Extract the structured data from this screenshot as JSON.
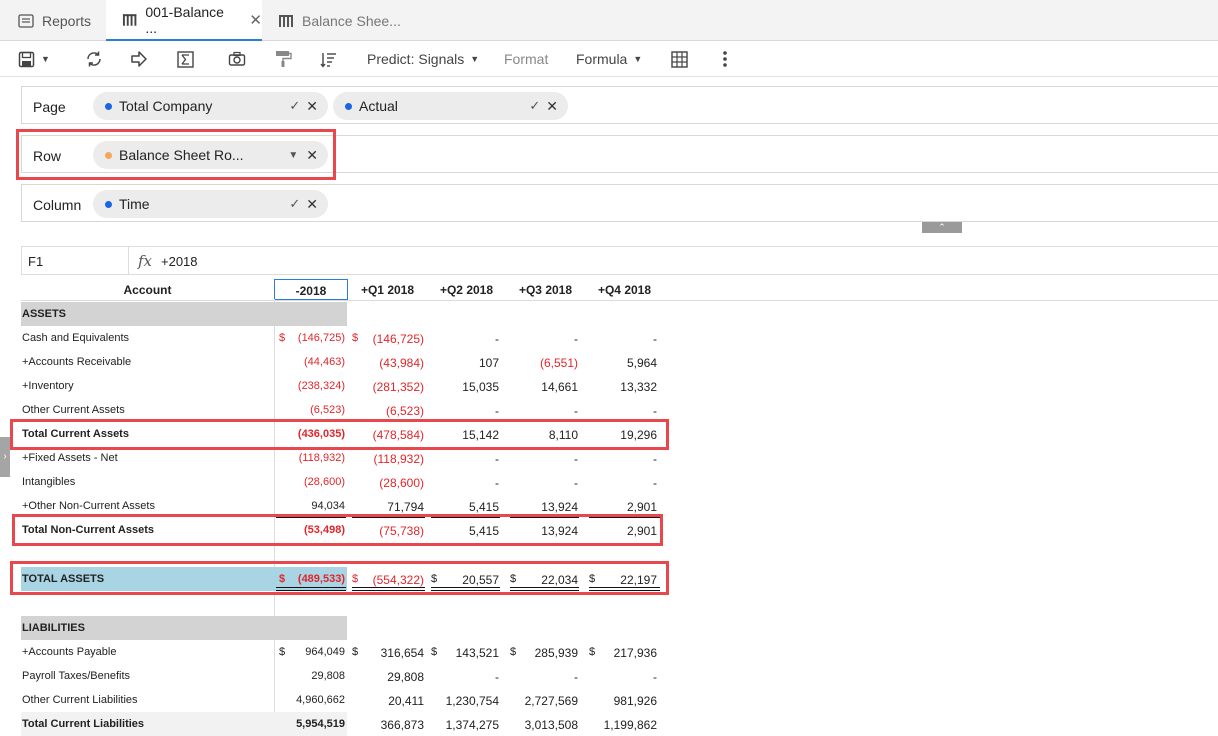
{
  "tabs": [
    {
      "label": "Reports",
      "icon": "reports-icon"
    },
    {
      "label": "001-Balance ...",
      "icon": "grid-report-icon"
    },
    {
      "label": "Balance Shee...",
      "icon": "grid-report-icon"
    }
  ],
  "toolbar": {
    "predict": "Predict: Signals",
    "format": "Format",
    "formula": "Formula"
  },
  "filters": {
    "page_label": "Page",
    "page_chip1": "Total Company",
    "page_chip2": "Actual",
    "row_label": "Row",
    "row_chip": "Balance Sheet Ro...",
    "column_label": "Column",
    "column_chip": "Time"
  },
  "colors": {
    "accent": "#2a7fd4",
    "negative": "#e0262c",
    "highlight": "#e8484d",
    "dot_blue": "#1a66e0",
    "dot_orange": "#f5a75b",
    "total_assets_bg": "#a9d4e4"
  },
  "formula_bar": {
    "cell": "F1",
    "fx": "fx",
    "value": "+2018"
  },
  "grid": {
    "headers": [
      "Account",
      "-2018",
      "+Q1 2018",
      "+Q2 2018",
      "+Q3 2018",
      "+Q4 2018"
    ],
    "rows": [
      {
        "account": "ASSETS"
      },
      {
        "account": "Cash and Equivalents",
        "c1": "$",
        "v1": "(146,725)",
        "c2": "$",
        "v2": "(146,725)",
        "v3": "-",
        "v4": "-",
        "v5": "-"
      },
      {
        "account": "+Accounts Receivable",
        "v1": "(44,463)",
        "v2": "(43,984)",
        "v3": "107",
        "v4": "(6,551)",
        "v5": "5,964"
      },
      {
        "account": "+Inventory",
        "v1": "(238,324)",
        "v2": "(281,352)",
        "v3": "15,035",
        "v4": "14,661",
        "v5": "13,332"
      },
      {
        "account": "Other Current Assets",
        "v1": "(6,523)",
        "v2": "(6,523)",
        "v3": "-",
        "v4": "-",
        "v5": "-"
      },
      {
        "account": "Total Current Assets",
        "v1": "(436,035)",
        "v2": "(478,584)",
        "v3": "15,142",
        "v4": "8,110",
        "v5": "19,296"
      },
      {
        "account": "+Fixed Assets - Net",
        "v1": "(118,932)",
        "v2": "(118,932)",
        "v3": "-",
        "v4": "-",
        "v5": "-"
      },
      {
        "account": "Intangibles",
        "v1": "(28,600)",
        "v2": "(28,600)",
        "v3": "-",
        "v4": "-",
        "v5": "-"
      },
      {
        "account": "+Other Non-Current Assets",
        "v1": "94,034",
        "v2": "71,794",
        "v3": "5,415",
        "v4": "13,924",
        "v5": "2,901"
      },
      {
        "account": "Total Non-Current Assets",
        "v1": "(53,498)",
        "v2": "(75,738)",
        "v3": "5,415",
        "v4": "13,924",
        "v5": "2,901"
      },
      {
        "account": "TOTAL ASSETS",
        "c1": "$",
        "v1": "(489,533)",
        "c2": "$",
        "v2": "(554,322)",
        "c3": "$",
        "v3": "20,557",
        "c4": "$",
        "v4": "22,034",
        "c5": "$",
        "v5": "22,197"
      },
      {
        "account": "LIABILITIES"
      },
      {
        "account": "+Accounts Payable",
        "c1": "$",
        "v1": "964,049",
        "c2": "$",
        "v2": "316,654",
        "c3": "$",
        "v3": "143,521",
        "c4": "$",
        "v4": "285,939",
        "c5": "$",
        "v5": "217,936"
      },
      {
        "account": "Payroll Taxes/Benefits",
        "v1": "29,808",
        "v2": "29,808",
        "v3": "-",
        "v4": "-",
        "v5": "-"
      },
      {
        "account": "Other Current Liabilities",
        "v1": "4,960,662",
        "v2": "20,411",
        "v3": "1,230,754",
        "v4": "2,727,569",
        "v5": "981,926"
      },
      {
        "account": "Total Current Liabilities",
        "v1": "5,954,519",
        "v2": "366,873",
        "v3": "1,374,275",
        "v4": "3,013,508",
        "v5": "1,199,862"
      }
    ]
  }
}
